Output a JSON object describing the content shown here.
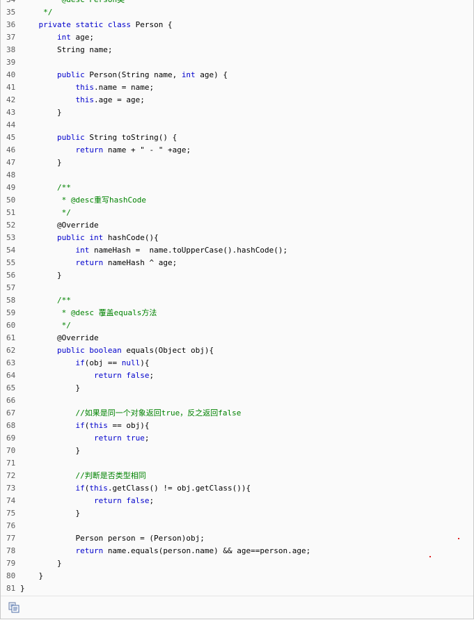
{
  "lines": [
    {
      "n": "34",
      "parts": [
        [
          "cm",
          "         @desc Person类"
        ]
      ]
    },
    {
      "n": "35",
      "parts": [
        [
          "cm",
          "     */"
        ]
      ]
    },
    {
      "n": "36",
      "parts": [
        [
          "txt",
          "    "
        ],
        [
          "kw",
          "private static class"
        ],
        [
          "txt",
          " Person {"
        ]
      ]
    },
    {
      "n": "37",
      "parts": [
        [
          "txt",
          "        "
        ],
        [
          "kw",
          "int"
        ],
        [
          "txt",
          " age;"
        ]
      ]
    },
    {
      "n": "38",
      "parts": [
        [
          "txt",
          "        String name;"
        ]
      ]
    },
    {
      "n": "39",
      "parts": []
    },
    {
      "n": "40",
      "parts": [
        [
          "txt",
          "        "
        ],
        [
          "kw",
          "public"
        ],
        [
          "txt",
          " Person(String name, "
        ],
        [
          "kw",
          "int"
        ],
        [
          "txt",
          " age) {"
        ]
      ]
    },
    {
      "n": "41",
      "parts": [
        [
          "txt",
          "            "
        ],
        [
          "kw",
          "this"
        ],
        [
          "txt",
          ".name = name;"
        ]
      ]
    },
    {
      "n": "42",
      "parts": [
        [
          "txt",
          "            "
        ],
        [
          "kw",
          "this"
        ],
        [
          "txt",
          ".age = age;"
        ]
      ]
    },
    {
      "n": "43",
      "parts": [
        [
          "txt",
          "        }"
        ]
      ]
    },
    {
      "n": "44",
      "parts": []
    },
    {
      "n": "45",
      "parts": [
        [
          "txt",
          "        "
        ],
        [
          "kw",
          "public"
        ],
        [
          "txt",
          " String toString() {"
        ]
      ]
    },
    {
      "n": "46",
      "parts": [
        [
          "txt",
          "            "
        ],
        [
          "kw",
          "return"
        ],
        [
          "txt",
          " name + "
        ],
        [
          "st",
          "\" - \""
        ],
        [
          "txt",
          " +age;"
        ]
      ]
    },
    {
      "n": "47",
      "parts": [
        [
          "txt",
          "        }"
        ]
      ]
    },
    {
      "n": "48",
      "parts": []
    },
    {
      "n": "49",
      "parts": [
        [
          "cm",
          "        /**"
        ]
      ]
    },
    {
      "n": "50",
      "parts": [
        [
          "cm",
          "         * @desc重写hashCode"
        ]
      ]
    },
    {
      "n": "51",
      "parts": [
        [
          "cm",
          "         */"
        ]
      ]
    },
    {
      "n": "52",
      "parts": [
        [
          "txt",
          "        @Override"
        ]
      ]
    },
    {
      "n": "53",
      "parts": [
        [
          "txt",
          "        "
        ],
        [
          "kw",
          "public int"
        ],
        [
          "txt",
          " hashCode(){"
        ]
      ]
    },
    {
      "n": "54",
      "parts": [
        [
          "txt",
          "            "
        ],
        [
          "kw",
          "int"
        ],
        [
          "txt",
          " nameHash =  name.toUpperCase().hashCode();"
        ]
      ]
    },
    {
      "n": "55",
      "parts": [
        [
          "txt",
          "            "
        ],
        [
          "kw",
          "return"
        ],
        [
          "txt",
          " nameHash ^ age;"
        ]
      ]
    },
    {
      "n": "56",
      "parts": [
        [
          "txt",
          "        }"
        ]
      ]
    },
    {
      "n": "57",
      "parts": []
    },
    {
      "n": "58",
      "parts": [
        [
          "cm",
          "        /**"
        ]
      ]
    },
    {
      "n": "59",
      "parts": [
        [
          "cm",
          "         * @desc 覆盖equals方法"
        ]
      ]
    },
    {
      "n": "60",
      "parts": [
        [
          "cm",
          "         */"
        ]
      ]
    },
    {
      "n": "61",
      "parts": [
        [
          "txt",
          "        @Override"
        ]
      ]
    },
    {
      "n": "62",
      "parts": [
        [
          "txt",
          "        "
        ],
        [
          "kw",
          "public boolean"
        ],
        [
          "txt",
          " equals(Object obj){"
        ]
      ]
    },
    {
      "n": "63",
      "parts": [
        [
          "txt",
          "            "
        ],
        [
          "kw",
          "if"
        ],
        [
          "txt",
          "(obj == "
        ],
        [
          "kw",
          "null"
        ],
        [
          "txt",
          "){"
        ]
      ]
    },
    {
      "n": "64",
      "parts": [
        [
          "txt",
          "                "
        ],
        [
          "kw",
          "return false"
        ],
        [
          "txt",
          ";"
        ]
      ]
    },
    {
      "n": "65",
      "parts": [
        [
          "txt",
          "            }"
        ]
      ]
    },
    {
      "n": "66",
      "parts": []
    },
    {
      "n": "67",
      "parts": [
        [
          "cm",
          "            //如果是同一个对象返回true，反之返回false"
        ]
      ]
    },
    {
      "n": "68",
      "parts": [
        [
          "txt",
          "            "
        ],
        [
          "kw",
          "if"
        ],
        [
          "txt",
          "("
        ],
        [
          "kw",
          "this"
        ],
        [
          "txt",
          " == obj){"
        ]
      ]
    },
    {
      "n": "69",
      "parts": [
        [
          "txt",
          "                "
        ],
        [
          "kw",
          "return true"
        ],
        [
          "txt",
          ";"
        ]
      ]
    },
    {
      "n": "70",
      "parts": [
        [
          "txt",
          "            }"
        ]
      ]
    },
    {
      "n": "71",
      "parts": []
    },
    {
      "n": "72",
      "parts": [
        [
          "cm",
          "            //判断是否类型相同"
        ]
      ]
    },
    {
      "n": "73",
      "parts": [
        [
          "txt",
          "            "
        ],
        [
          "kw",
          "if"
        ],
        [
          "txt",
          "("
        ],
        [
          "kw",
          "this"
        ],
        [
          "txt",
          ".getClass() != obj.getClass()){"
        ]
      ]
    },
    {
      "n": "74",
      "parts": [
        [
          "txt",
          "                "
        ],
        [
          "kw",
          "return false"
        ],
        [
          "txt",
          ";"
        ]
      ]
    },
    {
      "n": "75",
      "parts": [
        [
          "txt",
          "            }"
        ]
      ]
    },
    {
      "n": "76",
      "parts": []
    },
    {
      "n": "77",
      "parts": [
        [
          "txt",
          "            Person person = (Person)obj;"
        ]
      ]
    },
    {
      "n": "78",
      "parts": [
        [
          "txt",
          "            "
        ],
        [
          "kw",
          "return"
        ],
        [
          "txt",
          " name.equals(person.name) && age==person.age;"
        ]
      ]
    },
    {
      "n": "79",
      "parts": [
        [
          "txt",
          "        }"
        ]
      ]
    },
    {
      "n": "80",
      "parts": [
        [
          "txt",
          "    }"
        ]
      ]
    },
    {
      "n": "81",
      "parts": [
        [
          "txt",
          "}"
        ]
      ]
    }
  ],
  "footer": {
    "icon": "copy-icon"
  },
  "colors": {
    "keyword": "#0000cc",
    "comment": "#008200",
    "line_number": "#5c5c5c",
    "background": "#fafafa"
  }
}
